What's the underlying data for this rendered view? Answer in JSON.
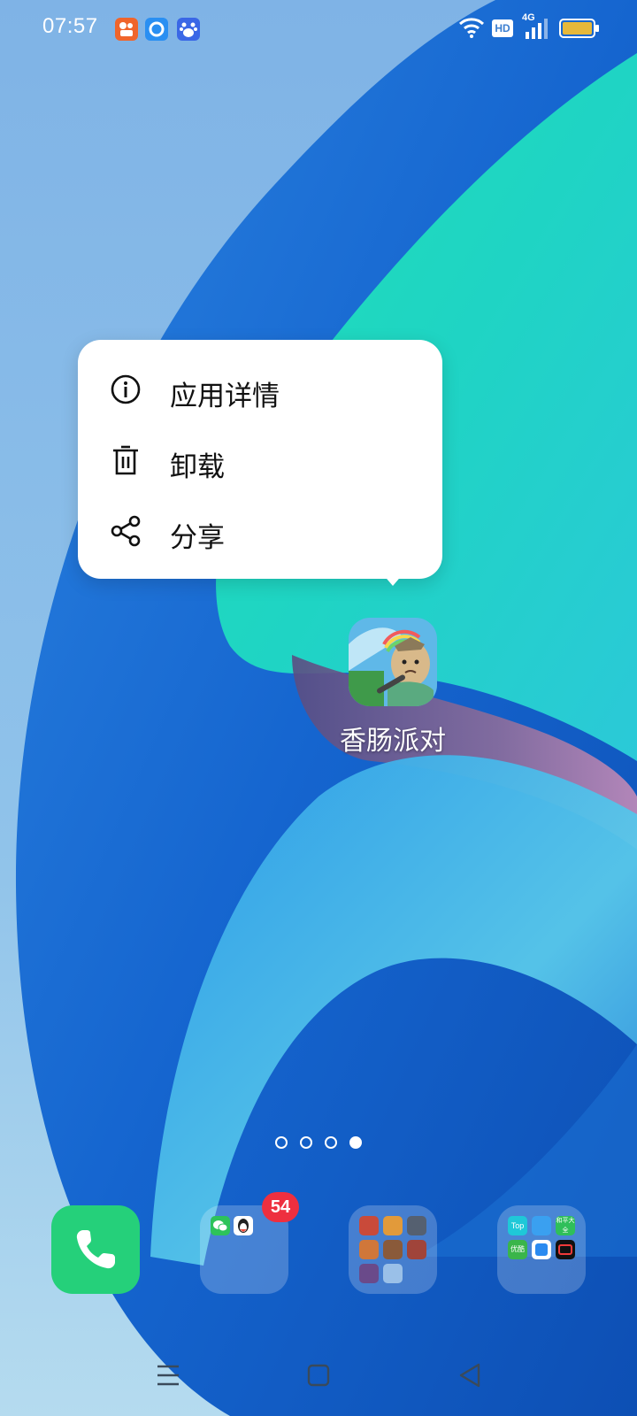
{
  "status_bar": {
    "time": "07:57",
    "notification_icons": [
      "kuaishou-icon",
      "browser-icon",
      "baidu-icon"
    ],
    "hd_label": "HD",
    "network_label": "4G",
    "battery_color": "#e6b83a"
  },
  "context_menu": {
    "items": [
      {
        "label": "应用详情",
        "icon": "info-icon"
      },
      {
        "label": "卸载",
        "icon": "trash-icon"
      },
      {
        "label": "分享",
        "icon": "share-icon"
      }
    ]
  },
  "selected_app": {
    "label": "香肠派对",
    "icon": "sausage-party-app-icon"
  },
  "page_indicator": {
    "total_pages": 4,
    "current_page": 4
  },
  "dock": {
    "phone_icon": "phone-icon",
    "social_folder": {
      "badge_count": "54",
      "apps": [
        "wechat-icon",
        "qq-icon"
      ]
    },
    "games_folder": {
      "apps": [
        "game-icon",
        "game-icon",
        "game-icon",
        "game-icon",
        "game-icon",
        "game-icon",
        "game-icon",
        "game-icon"
      ]
    },
    "tools_folder": {
      "app_labels": [
        "Top",
        "",
        "和平大全",
        "优酷",
        "",
        ""
      ]
    }
  },
  "nav_bar": {
    "buttons": [
      "menu-icon",
      "home-icon",
      "back-icon"
    ]
  },
  "colors": {
    "wallpaper_teal": "#1fd8b7",
    "wallpaper_blue": "#1a6fd6",
    "phone_green": "#25d07a",
    "badge_red": "#ee2f3f"
  }
}
